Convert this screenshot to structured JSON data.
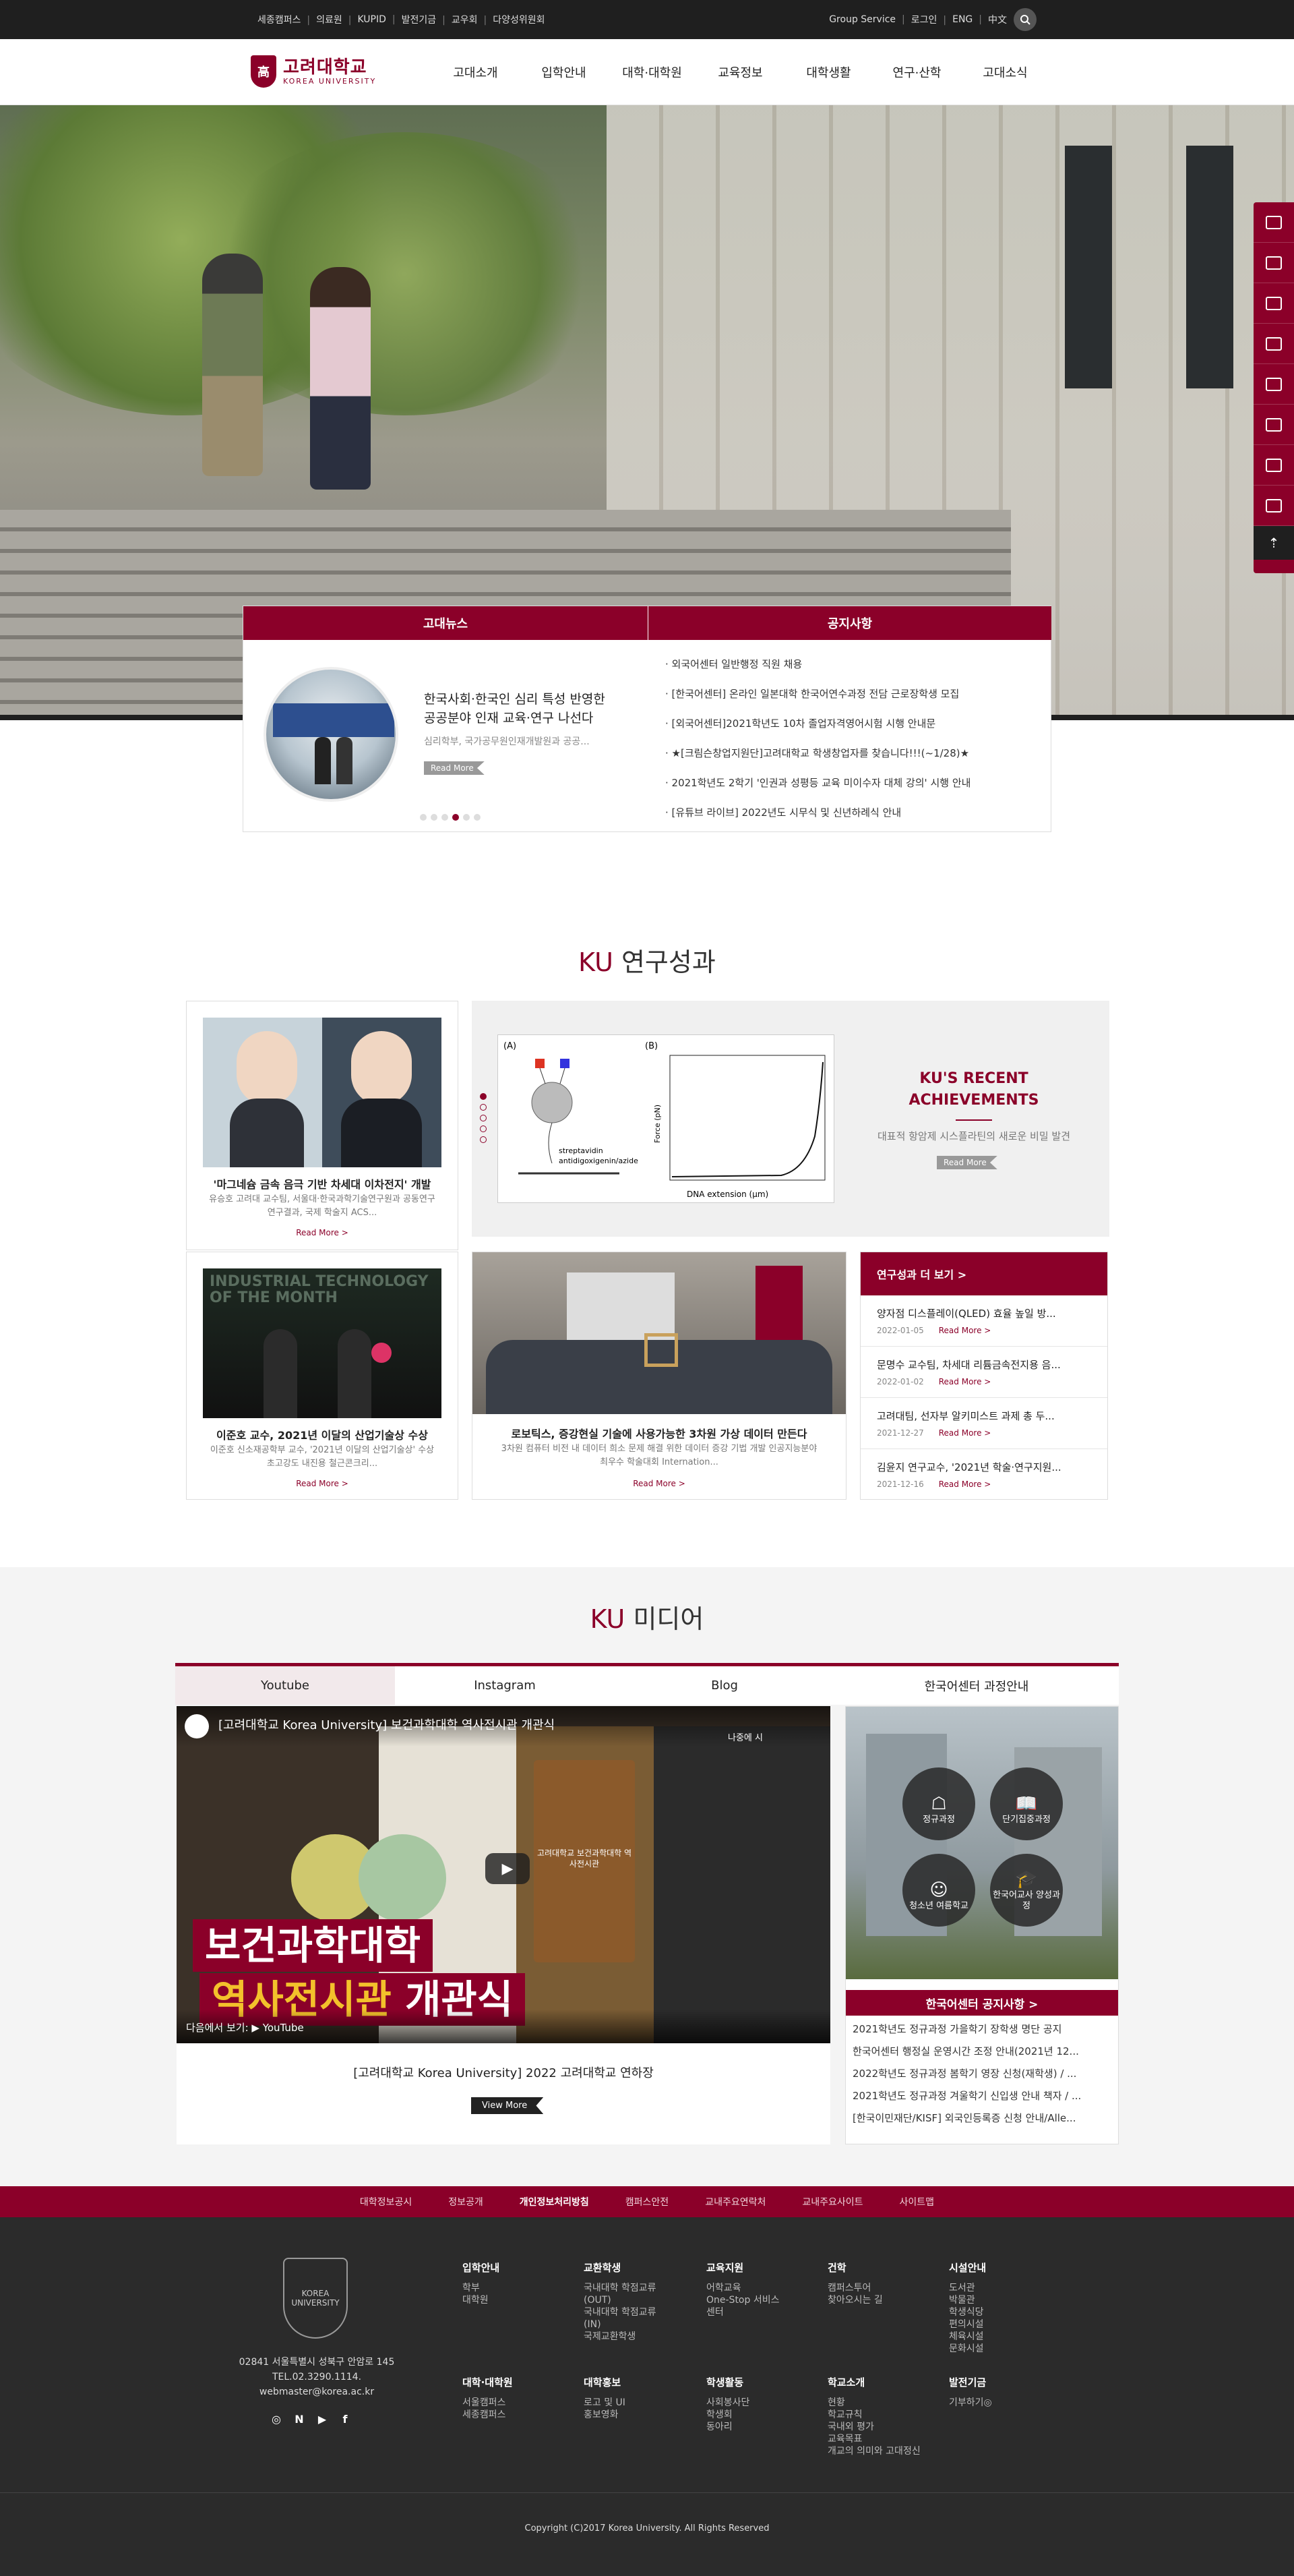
{
  "topbar": {
    "left_links": [
      "세종캠퍼스",
      "의료원",
      "KUPID",
      "발전기금",
      "교우회",
      "다양성위원회"
    ],
    "right_links": [
      "Group Service",
      "로그인",
      "ENG",
      "中文"
    ]
  },
  "logo": {
    "ko": "고려대학교",
    "en": "KOREA UNIVERSITY",
    "crest": "高"
  },
  "gnb": [
    "고대소개",
    "입학안내",
    "대학·대학원",
    "교육정보",
    "대학생활",
    "연구·산학",
    "고대소식"
  ],
  "quick_menu": {
    "top": "⇡"
  },
  "news": {
    "tab": "고대뉴스",
    "title": "한국사회·한국인 심리 특성 반영한 공공분야 인재 교육·연구 나선다",
    "desc": "심리학부, 국가공무원인재개발원과 공공...",
    "readmore": "Read More"
  },
  "notice": {
    "tab": "공지사항",
    "items": [
      "· 외국어센터 일반행정 직원 채용",
      "· [한국어센터] 온라인 일본대학 한국어연수과정 전담 근로장학생 모집",
      "· [외국어센터]2021학년도 10차 졸업자격영어시험 시행 안내문",
      "· ★[크림슨창업지원단]고려대학교 학생창업자를 찾습니다!!!(~1/28)★",
      "· 2021학년도 2학기 '인권과 성평등 교육 미이수자 대체 강의' 시행 안내",
      "· [유튜브 라이브] 2022년도 시무식 및 신년하례식 안내"
    ]
  },
  "research": {
    "title_ku": "KU",
    "title_rest": " 연구성과",
    "card1": {
      "title": "'마그네슘 금속 음극 기반 차세대 이차전지' 개발",
      "desc": "유승호 고려대 교수팀, 서울대·한국과학기술연구원과 공동연구 연구결과, 국제 학술지 ACS...",
      "more": "Read More >"
    },
    "achieve": {
      "title": "KU'S RECENT ACHIEVEMENTS",
      "desc": "대표적 항암제 시스플라틴의 새로운 비밀 발견",
      "readmore": "Read More",
      "fig_a": "(A)",
      "fig_b": "(B)",
      "fig_label1": "streptavidin",
      "fig_label2": "antidigoxigenin/azide",
      "fig_ylabel": "Force (pN)",
      "fig_xlabel": "DNA extension (μm)"
    },
    "card2": {
      "title": "이준호 교수, 2021년 이달의 산업기술상 수상",
      "desc": "이준호 신소재공학부 교수, '2021년 이달의 산업기술상' 수상 초고강도 내진용 철근콘크리...",
      "more": "Read More >",
      "banner": "INDUSTRIAL TECHNOLOGY OF THE MONTH"
    },
    "card3": {
      "title": "로보틱스, 증강현실 기술에 사용가능한 3차원 가상 데이터 만든다",
      "desc": "3차원 컴퓨터 비전 내 데이터 희소 문제 해결 위한 데이터 증강 기법 개발 인공지능분야 최우수 학술대회 Internation...",
      "more": "Read More >"
    },
    "more_box": {
      "header": "연구성과 더 보기 >",
      "items": [
        {
          "title": "양자점 디스플레이(QLED) 효율 높일 방...",
          "date": "2022-01-05",
          "more": "Read More >"
        },
        {
          "title": "문명수 교수팀, 차세대 리튬금속전지용 음...",
          "date": "2022-01-02",
          "more": "Read More >"
        },
        {
          "title": "고려대팀, 선자부 알키미스트 과제 총 두...",
          "date": "2021-12-27",
          "more": "Read More >"
        },
        {
          "title": "김윤지 연구교수, '2021년 학술·연구지원...",
          "date": "2021-12-16",
          "more": "Read More >"
        }
      ]
    }
  },
  "media": {
    "title_ku": "KU",
    "title_rest": " 미디어",
    "tabs": [
      "Youtube",
      "Instagram",
      "Blog",
      "한국어센터 과정안내"
    ],
    "video": {
      "header": "[고려대학교 Korea University] 보건과학대학 역사전시관 개관식",
      "cap1": "보건과학대학",
      "cap2a": "역사전시관",
      "cap2b": " 개관식",
      "bottom": "다음에서 보기:  ▶ YouTube",
      "watch_later": "나중에 시",
      "exhibit": "고려대학교 보건과학대학 역사전시관"
    },
    "video_title": "[고려대학교 Korea University] 2022 고려대학교 연하장",
    "view_more": "View More",
    "korea_center": {
      "icons": [
        {
          "label": "정규과정",
          "glyph": "☖"
        },
        {
          "label": "단기집중과정",
          "glyph": "📖"
        },
        {
          "label": "청소년 여름학교",
          "glyph": "☺"
        },
        {
          "label": "한국어교사 양성과정",
          "glyph": "🎓"
        }
      ],
      "header": "한국어센터 공지사항 >",
      "items": [
        "2021학년도 정규과정 가을학기 장학생 명단 공지",
        "한국어센터 행정실 운영시간 조정 안내(2021년 12...",
        "2022학년도 정규과정 봄학기 영장 신청(재학생) / ...",
        "2021학년도 정규과정 겨울학기 신입생 안내 책자 / ...",
        "[한국이민재단/KISF] 외국인등록증 신청 안내/Alle..."
      ]
    }
  },
  "footer_nav": [
    {
      "label": "대학정보공시",
      "strong": false
    },
    {
      "label": "정보공개",
      "strong": false
    },
    {
      "label": "개인정보처리방침",
      "strong": true
    },
    {
      "label": "캠퍼스안전",
      "strong": false
    },
    {
      "label": "교내주요연락처",
      "strong": false
    },
    {
      "label": "교내주요사이트",
      "strong": false
    },
    {
      "label": "사이트맵",
      "strong": false
    }
  ],
  "footer": {
    "emblem": "KOREA UNIVERSITY",
    "address": "02841 서울특별시 성북구 안암로 145",
    "tel": "TEL.02.3290.1114.",
    "email": "webmaster@korea.ac.kr",
    "sns": [
      "◎",
      "N",
      "▶",
      "f"
    ],
    "columns_top": [
      {
        "title": "입학안내",
        "items": [
          "학부",
          "대학원"
        ]
      },
      {
        "title": "교환학생",
        "items": [
          "국내대학 학점교류 (OUT)",
          "국내대학 학점교류 (IN)",
          "국제교환학생"
        ]
      },
      {
        "title": "교육지원",
        "items": [
          "어학교육",
          "One-Stop 서비스센터"
        ]
      },
      {
        "title": "건학",
        "items": [
          "캠퍼스투어",
          "찾아오시는 길"
        ]
      },
      {
        "title": "시설안내",
        "items": [
          "도서관",
          "박물관",
          "학생식당",
          "편의시설",
          "체육시설",
          "문화시설"
        ]
      }
    ],
    "columns_bottom": [
      {
        "title": "대학·대학원",
        "items": [
          "서울캠퍼스",
          "세종캠퍼스"
        ]
      },
      {
        "title": "대학홍보",
        "items": [
          "로고 및 UI",
          "홍보영화"
        ]
      },
      {
        "title": "학생활동",
        "items": [
          "사회봉사단",
          "학생회",
          "동아리"
        ]
      },
      {
        "title": "학교소개",
        "items": [
          "현황",
          "학교규칙",
          "국내외 평가",
          "교육목표",
          "개교의 의미와 고대정신"
        ]
      },
      {
        "title": "발전기금",
        "items": [
          "기부하기◎"
        ]
      }
    ],
    "copyright": "Copyright (C)2017 Korea University. All Rights Reserved"
  },
  "colors": {
    "brand": "#8b0029",
    "dark": "#1f1f1f"
  }
}
